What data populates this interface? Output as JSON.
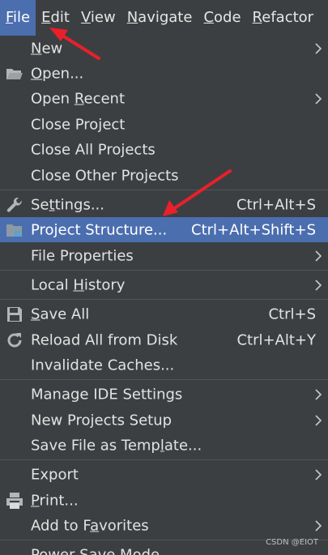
{
  "menubar": {
    "items": [
      {
        "pre": "",
        "mn": "F",
        "post": "ile"
      },
      {
        "pre": "",
        "mn": "E",
        "post": "dit"
      },
      {
        "pre": "",
        "mn": "V",
        "post": "iew"
      },
      {
        "pre": "",
        "mn": "N",
        "post": "avigate"
      },
      {
        "pre": "",
        "mn": "C",
        "post": "ode"
      },
      {
        "pre": "",
        "mn": "R",
        "post": "efactor"
      }
    ]
  },
  "file_menu": {
    "new": {
      "pre": "",
      "mn": "N",
      "post": "ew"
    },
    "open": {
      "pre": "",
      "mn": "O",
      "post": "pen..."
    },
    "open_recent": {
      "pre": "Open ",
      "mn": "R",
      "post": "ecent"
    },
    "close_project": {
      "pre": "Close Project",
      "mn": "",
      "post": ""
    },
    "close_all_projects": {
      "pre": "Close All Projects",
      "mn": "",
      "post": ""
    },
    "close_other_projects": {
      "pre": "Close Other Projects",
      "mn": "",
      "post": ""
    },
    "settings": {
      "pre": "Se",
      "mn": "t",
      "post": "tings...",
      "shortcut": "Ctrl+Alt+S"
    },
    "project_structure": {
      "pre": "Project Structure...",
      "mn": "",
      "post": "",
      "shortcut": "Ctrl+Alt+Shift+S"
    },
    "file_properties": {
      "pre": "File Properties",
      "mn": "",
      "post": ""
    },
    "local_history": {
      "pre": "Local ",
      "mn": "H",
      "post": "istory"
    },
    "save_all": {
      "pre": "",
      "mn": "S",
      "post": "ave All",
      "shortcut": "Ctrl+S"
    },
    "reload_all": {
      "pre": "Reload All from Disk",
      "mn": "",
      "post": "",
      "shortcut": "Ctrl+Alt+Y"
    },
    "invalidate_caches": {
      "pre": "Invalidate Caches...",
      "mn": "",
      "post": ""
    },
    "manage_ide_settings": {
      "pre": "Manage IDE Settings",
      "mn": "",
      "post": ""
    },
    "new_projects_setup": {
      "pre": "New Projects Setup",
      "mn": "",
      "post": ""
    },
    "save_file_as_template": {
      "pre": "Save File as Temp",
      "mn": "l",
      "post": "ate..."
    },
    "export": {
      "pre": "Export",
      "mn": "",
      "post": ""
    },
    "print": {
      "pre": "",
      "mn": "P",
      "post": "rint..."
    },
    "add_to_favorites": {
      "pre": "Add to F",
      "mn": "a",
      "post": "vorites"
    },
    "power_save_mode": {
      "pre": "Power Save Mode",
      "mn": "",
      "post": ""
    }
  },
  "watermark": "CSDN @EIOT",
  "colors": {
    "menu_bg": "#3c3f41",
    "highlight": "#4b6eaf",
    "text": "#e2e2e2",
    "annotation_arrow": "#e8202a"
  },
  "icons": {
    "open": "folder-open-icon",
    "settings": "wrench-icon",
    "project_structure": "project-structure-icon",
    "save_all": "save-icon",
    "reload_all": "reload-icon",
    "print": "print-icon"
  }
}
